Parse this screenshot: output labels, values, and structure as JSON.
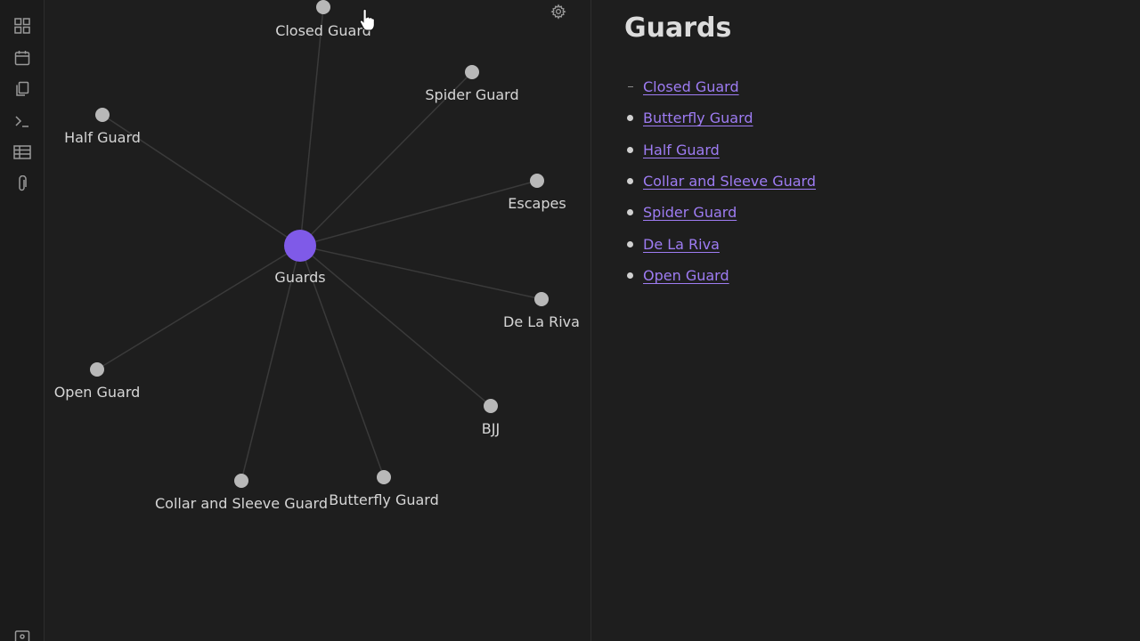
{
  "ribbon": {
    "icons": [
      "grid-icon",
      "calendar-icon",
      "copy-icon",
      "terminal-icon",
      "table-icon",
      "paperclip-icon"
    ],
    "bottom_icon": "help-icon"
  },
  "graph": {
    "settings_icon": "gear-icon",
    "center": {
      "label": "Guards",
      "color": "#7f5ae8"
    },
    "node_color": "#b8b8b8",
    "edge_color": "#3a3a3a",
    "nodes": [
      {
        "id": "closed-guard",
        "label": "Closed Guard"
      },
      {
        "id": "spider-guard",
        "label": "Spider Guard"
      },
      {
        "id": "half-guard",
        "label": "Half Guard"
      },
      {
        "id": "escapes",
        "label": "Escapes"
      },
      {
        "id": "de-la-riva",
        "label": "De La Riva"
      },
      {
        "id": "open-guard",
        "label": "Open Guard"
      },
      {
        "id": "bjj",
        "label": "BJJ"
      },
      {
        "id": "collar-and-sleeve-guard",
        "label": "Collar and Sleeve Guard"
      },
      {
        "id": "butterfly-guard",
        "label": "Butterfly Guard"
      }
    ]
  },
  "note": {
    "title": "Guards",
    "link_color": "#9e7cf3",
    "links": [
      {
        "label": "Closed Guard",
        "bullet": "dash"
      },
      {
        "label": "Butterfly Guard",
        "bullet": "dot"
      },
      {
        "label": "Half Guard",
        "bullet": "dot"
      },
      {
        "label": "Collar and Sleeve Guard",
        "bullet": "dot"
      },
      {
        "label": "Spider Guard",
        "bullet": "dot"
      },
      {
        "label": "De La Riva",
        "bullet": "dot"
      },
      {
        "label": "Open Guard",
        "bullet": "dot"
      }
    ]
  }
}
